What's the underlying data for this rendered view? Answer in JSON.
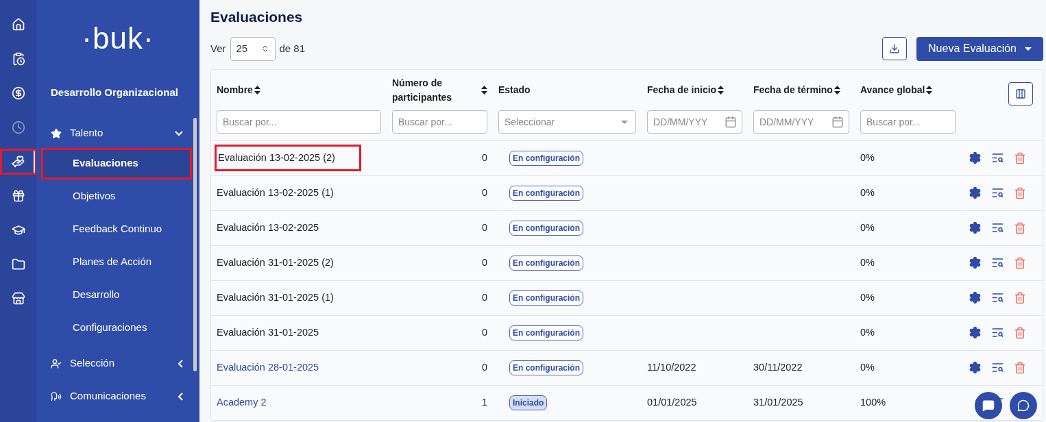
{
  "rail": [
    {
      "selected": false,
      "dimmed": false,
      "highlighted": false
    },
    {
      "selected": false,
      "dimmed": false,
      "highlighted": false
    },
    {
      "selected": false,
      "dimmed": false,
      "highlighted": false
    },
    {
      "selected": false,
      "dimmed": true,
      "highlighted": false
    },
    {
      "selected": true,
      "dimmed": false,
      "highlighted": true
    },
    {
      "selected": false,
      "dimmed": false,
      "highlighted": false
    },
    {
      "selected": false,
      "dimmed": false,
      "highlighted": false
    },
    {
      "selected": false,
      "dimmed": false,
      "highlighted": false
    },
    {
      "selected": false,
      "dimmed": false,
      "highlighted": false
    }
  ],
  "sidebar": {
    "logo": "·buk·",
    "section": "Desarrollo Organizacional",
    "groups": [
      {
        "label": "Talento",
        "expanded": true,
        "children": [
          {
            "label": "Evaluaciones",
            "selected": true,
            "highlighted": true
          },
          {
            "label": "Objetivos",
            "selected": false,
            "highlighted": false
          },
          {
            "label": "Feedback Continuo",
            "selected": false,
            "highlighted": false
          },
          {
            "label": "Planes de Acción",
            "selected": false,
            "highlighted": false
          },
          {
            "label": "Desarrollo",
            "selected": false,
            "highlighted": false
          },
          {
            "label": "Configuraciones",
            "selected": false,
            "highlighted": false
          }
        ]
      },
      {
        "label": "Selección",
        "expanded": false
      },
      {
        "label": "Comunicaciones",
        "expanded": false
      }
    ]
  },
  "page": {
    "title": "Evaluaciones",
    "show_label": "Ver",
    "page_size": "25",
    "of_label": "de 81",
    "new_button": "Nueva Evaluación"
  },
  "table": {
    "columns": [
      {
        "label": "Nombre",
        "kind": "text",
        "placeholder": "Buscar por...",
        "sortable": true
      },
      {
        "label": "Número de participantes",
        "kind": "text",
        "placeholder": "Buscar por...",
        "sortable": true
      },
      {
        "label": "Estado",
        "kind": "select",
        "placeholder": "Seleccionar",
        "sortable": false
      },
      {
        "label": "Fecha de inicio",
        "kind": "date",
        "placeholder": "DD/MM/YYY",
        "sortable": true
      },
      {
        "label": "Fecha de término",
        "kind": "date",
        "placeholder": "DD/MM/YYY",
        "sortable": true
      },
      {
        "label": "Avance global",
        "kind": "text",
        "placeholder": "Buscar por...",
        "sortable": true
      }
    ],
    "rows": [
      {
        "name": "Evaluación 13-02-2025 (2)",
        "linked": false,
        "highlighted": true,
        "participants": "0",
        "status": "En configuración",
        "kind": "outline",
        "start": "",
        "end": "",
        "progress": "0%",
        "deletable": true
      },
      {
        "name": "Evaluación 13-02-2025 (1)",
        "linked": false,
        "highlighted": false,
        "participants": "0",
        "status": "En configuración",
        "kind": "outline",
        "start": "",
        "end": "",
        "progress": "0%",
        "deletable": true
      },
      {
        "name": "Evaluación 13-02-2025",
        "linked": false,
        "highlighted": false,
        "participants": "0",
        "status": "En configuración",
        "kind": "outline",
        "start": "",
        "end": "",
        "progress": "0%",
        "deletable": true
      },
      {
        "name": "Evaluación 31-01-2025 (2)",
        "linked": false,
        "highlighted": false,
        "participants": "0",
        "status": "En configuración",
        "kind": "outline",
        "start": "",
        "end": "",
        "progress": "0%",
        "deletable": true
      },
      {
        "name": "Evaluación 31-01-2025 (1)",
        "linked": false,
        "highlighted": false,
        "participants": "0",
        "status": "En configuración",
        "kind": "outline",
        "start": "",
        "end": "",
        "progress": "0%",
        "deletable": true
      },
      {
        "name": "Evaluación 31-01-2025",
        "linked": false,
        "highlighted": false,
        "participants": "0",
        "status": "En configuración",
        "kind": "outline",
        "start": "",
        "end": "",
        "progress": "0%",
        "deletable": true
      },
      {
        "name": "Evaluación 28-01-2025",
        "linked": true,
        "highlighted": false,
        "participants": "0",
        "status": "En configuración",
        "kind": "outline",
        "start": "11/10/2022",
        "end": "30/11/2022",
        "progress": "0%",
        "deletable": true
      },
      {
        "name": "Academy 2",
        "linked": true,
        "highlighted": false,
        "participants": "1",
        "status": "Iniciado",
        "kind": "filled",
        "start": "01/01/2025",
        "end": "31/01/2025",
        "progress": "100%",
        "deletable": false
      }
    ]
  }
}
